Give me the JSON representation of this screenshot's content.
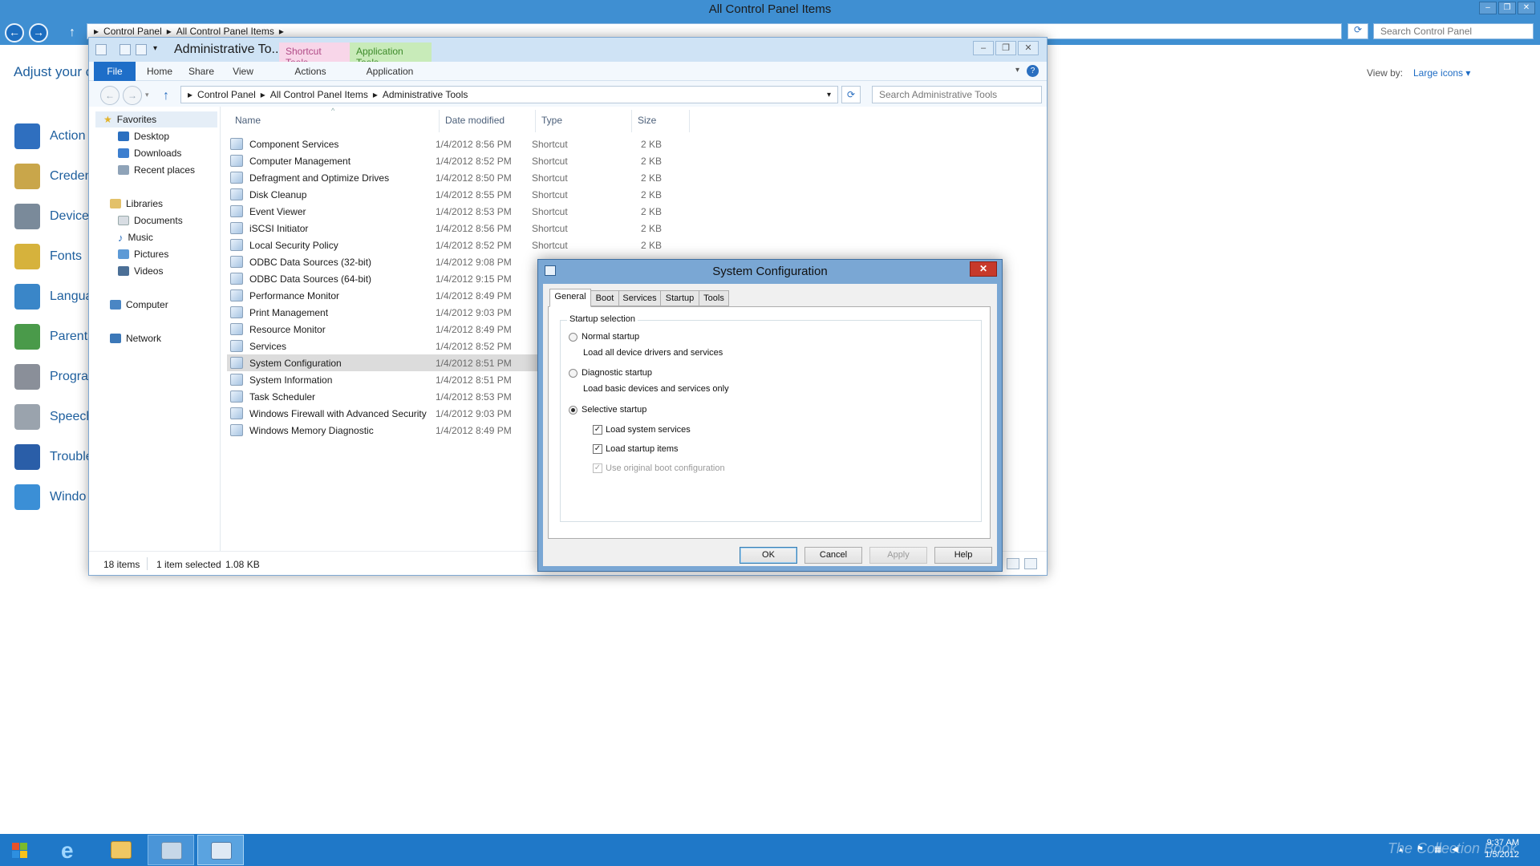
{
  "background_window": {
    "title": "All Control Panel Items",
    "breadcrumb": [
      "Control Panel",
      "All Control Panel Items"
    ],
    "search_placeholder": "Search Control Panel",
    "heading": "Adjust your c",
    "view_by_label": "View by:",
    "view_by_value": "Large icons",
    "items": [
      {
        "label": "Action",
        "icon": "action-center-flag-icon",
        "color": "#2f6fbf"
      },
      {
        "label": "Creden",
        "icon": "credential-manager-icon",
        "color": "#c9a64a"
      },
      {
        "label": "Devices",
        "icon": "devices-printers-icon",
        "color": "#7a8a9a"
      },
      {
        "label": "Fonts",
        "icon": "fonts-icon",
        "color": "#d6b23c"
      },
      {
        "label": "Langua",
        "icon": "language-icon",
        "color": "#3a86c8"
      },
      {
        "label": "Parenta",
        "icon": "parental-controls-icon",
        "color": "#4a9a4a"
      },
      {
        "label": "Progra",
        "icon": "programs-icon",
        "color": "#8a8f99"
      },
      {
        "label": "Speech",
        "icon": "speech-microphone-icon",
        "color": "#9aa3ad"
      },
      {
        "label": "Trouble",
        "icon": "troubleshooting-icon",
        "color": "#2a5ea8"
      },
      {
        "label": "Windo",
        "icon": "windows-update-icon",
        "color": "#3b8fd6"
      }
    ]
  },
  "explorer": {
    "title": "Administrative To...",
    "context_tabs": {
      "shortcut": "Shortcut Tools",
      "application": "Application Tools"
    },
    "ribbon_tabs": [
      "File",
      "Home",
      "Share",
      "View",
      "Actions",
      "Application"
    ],
    "breadcrumb": [
      "Control Panel",
      "All Control Panel Items",
      "Administrative Tools"
    ],
    "search_placeholder": "Search Administrative Tools",
    "nav": {
      "favorites": "Favorites",
      "favorites_items": [
        "Desktop",
        "Downloads",
        "Recent places"
      ],
      "libraries": "Libraries",
      "libraries_items": [
        "Documents",
        "Music",
        "Pictures",
        "Videos"
      ],
      "computer": "Computer",
      "network": "Network"
    },
    "columns": {
      "name": "Name",
      "date": "Date modified",
      "type": "Type",
      "size": "Size"
    },
    "files": [
      {
        "name": "Component Services",
        "date": "1/4/2012 8:56 PM",
        "type": "Shortcut",
        "size": "2 KB"
      },
      {
        "name": "Computer Management",
        "date": "1/4/2012 8:52 PM",
        "type": "Shortcut",
        "size": "2 KB"
      },
      {
        "name": "Defragment and Optimize Drives",
        "date": "1/4/2012 8:50 PM",
        "type": "Shortcut",
        "size": "2 KB"
      },
      {
        "name": "Disk Cleanup",
        "date": "1/4/2012 8:55 PM",
        "type": "Shortcut",
        "size": "2 KB"
      },
      {
        "name": "Event Viewer",
        "date": "1/4/2012 8:53 PM",
        "type": "Shortcut",
        "size": "2 KB"
      },
      {
        "name": "iSCSI Initiator",
        "date": "1/4/2012 8:56 PM",
        "type": "Shortcut",
        "size": "2 KB"
      },
      {
        "name": "Local Security Policy",
        "date": "1/4/2012 8:52 PM",
        "type": "Shortcut",
        "size": "2 KB"
      },
      {
        "name": "ODBC Data Sources (32-bit)",
        "date": "1/4/2012 9:08 PM",
        "type": "",
        "size": ""
      },
      {
        "name": "ODBC Data Sources (64-bit)",
        "date": "1/4/2012 9:15 PM",
        "type": "",
        "size": ""
      },
      {
        "name": "Performance Monitor",
        "date": "1/4/2012 8:49 PM",
        "type": "",
        "size": ""
      },
      {
        "name": "Print Management",
        "date": "1/4/2012 9:03 PM",
        "type": "",
        "size": ""
      },
      {
        "name": "Resource Monitor",
        "date": "1/4/2012 8:49 PM",
        "type": "",
        "size": ""
      },
      {
        "name": "Services",
        "date": "1/4/2012 8:52 PM",
        "type": "",
        "size": ""
      },
      {
        "name": "System Configuration",
        "date": "1/4/2012 8:51 PM",
        "type": "",
        "size": "",
        "selected": true
      },
      {
        "name": "System Information",
        "date": "1/4/2012 8:51 PM",
        "type": "",
        "size": ""
      },
      {
        "name": "Task Scheduler",
        "date": "1/4/2012 8:53 PM",
        "type": "",
        "size": ""
      },
      {
        "name": "Windows Firewall with Advanced Security",
        "date": "1/4/2012 9:03 PM",
        "type": "",
        "size": ""
      },
      {
        "name": "Windows Memory Diagnostic",
        "date": "1/4/2012 8:49 PM",
        "type": "",
        "size": ""
      }
    ],
    "status": {
      "count": "18 items",
      "selected": "1 item selected",
      "size": "1.08 KB"
    }
  },
  "msconfig": {
    "title": "System Configuration",
    "tabs": [
      "General",
      "Boot",
      "Services",
      "Startup",
      "Tools"
    ],
    "group_label": "Startup selection",
    "options": {
      "normal": {
        "label": "Normal startup",
        "desc": "Load all device drivers and services"
      },
      "diagnostic": {
        "label": "Diagnostic startup",
        "desc": "Load basic devices and services only"
      },
      "selective": {
        "label": "Selective startup"
      }
    },
    "selected_option": "selective",
    "checks": {
      "load_system_services": {
        "label": "Load system services",
        "checked": true
      },
      "load_startup_items": {
        "label": "Load startup items",
        "checked": true
      },
      "use_original_boot": {
        "label": "Use original boot configuration",
        "checked": true,
        "disabled": true
      }
    },
    "buttons": {
      "ok": "OK",
      "cancel": "Cancel",
      "apply": "Apply",
      "help": "Help"
    }
  },
  "taskbar": {
    "clock_time": "9:37 AM",
    "clock_date": "1/5/2012",
    "watermark": "The Collection Book"
  },
  "colors": {
    "accent": "#1e6ec8",
    "titlebar": "#3f8fd2",
    "taskbar": "#1f78c8",
    "shortcut_tools": "#f8d6e9",
    "application_tools": "#c8ebb9",
    "close_button": "#c7392b"
  }
}
